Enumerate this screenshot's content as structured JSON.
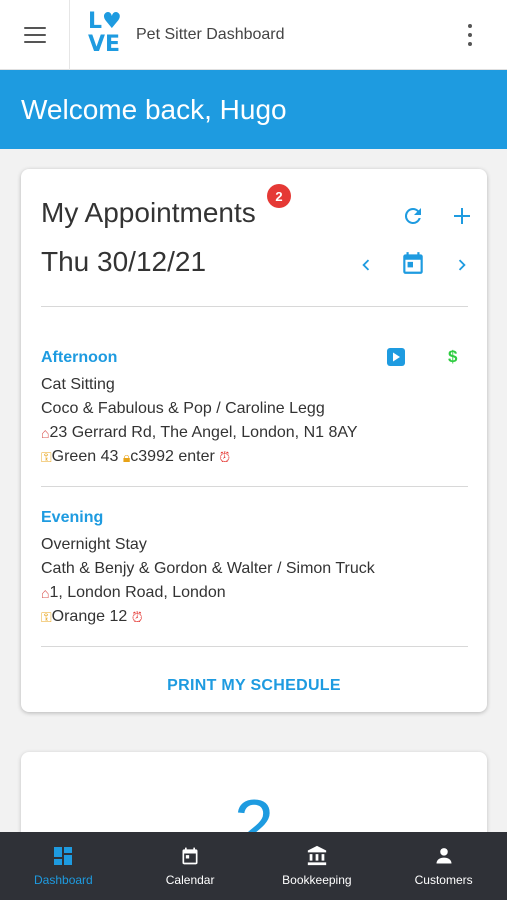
{
  "header": {
    "app_title": "Pet Sitter Dashboard",
    "logo_line1": "L♥",
    "logo_line2": "VE"
  },
  "welcome": "Welcome back, Hugo",
  "appointments": {
    "title": "My Appointments",
    "badge_count": "2",
    "date": "Thu 30/12/21",
    "items": [
      {
        "slot": "Afternoon",
        "service": "Cat Sitting",
        "pets_owner": "Coco & Fabulous & Pop / Caroline Legg",
        "address": "23 Gerrard Rd, The Angel, London, N1 8AY",
        "key": "Green 43",
        "lock": "c3992 enter"
      },
      {
        "slot": "Evening",
        "service": "Overnight Stay",
        "pets_owner": "Cath & Benjy & Gordon & Walter / Simon Truck",
        "address": "1, London Road, London",
        "key": "Orange 12"
      }
    ],
    "print_label": "PRINT MY SCHEDULE"
  },
  "second_card": {
    "big_text": "2"
  },
  "bottom_nav": [
    {
      "label": "Dashboard",
      "icon": "dashboard-icon",
      "active": true
    },
    {
      "label": "Calendar",
      "icon": "calendar-icon",
      "active": false
    },
    {
      "label": "Bookkeeping",
      "icon": "bank-icon",
      "active": false
    },
    {
      "label": "Customers",
      "icon": "person-icon",
      "active": false
    }
  ],
  "colors": {
    "accent": "#1e9be0",
    "badge": "#e53935",
    "money": "#2ecc40",
    "nav_bg": "#2f3137"
  }
}
